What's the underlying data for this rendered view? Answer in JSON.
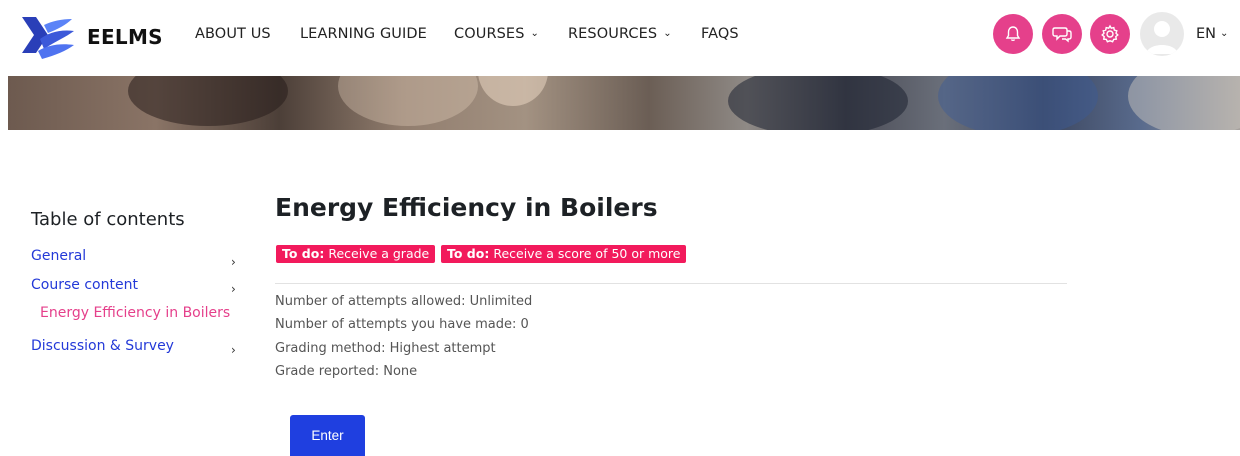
{
  "brand": {
    "name": "EELMS"
  },
  "nav": {
    "items": [
      {
        "label": "ABOUT US",
        "has_dropdown": false
      },
      {
        "label": "LEARNING GUIDE",
        "has_dropdown": false
      },
      {
        "label": "COURSES",
        "has_dropdown": true
      },
      {
        "label": "RESOURCES",
        "has_dropdown": true
      },
      {
        "label": "FAQS",
        "has_dropdown": false
      }
    ],
    "icons": [
      "bell-icon",
      "chat-icon",
      "gear-icon"
    ],
    "language": "EN",
    "accent_color": "#e5408b"
  },
  "toc": {
    "title": "Table of contents",
    "items": [
      {
        "label": "General",
        "active": false
      },
      {
        "label": "Course content",
        "active": false
      },
      {
        "label": "Energy Efficiency in Boilers",
        "active": true
      },
      {
        "label": "Discussion & Survey",
        "active": false
      }
    ]
  },
  "main": {
    "title": "Energy Efficiency in Boilers",
    "badges": [
      {
        "prefix": "To do:",
        "text": "Receive a grade"
      },
      {
        "prefix": "To do:",
        "text": "Receive a score of 50 or more"
      }
    ],
    "badge_color": "#f21a5c",
    "info": [
      "Number of attempts allowed: Unlimited",
      "Number of attempts you have made: 0",
      "Grading method: Highest attempt",
      "Grade reported: None"
    ],
    "enter_label": "Enter",
    "button_color": "#1f3fe0"
  }
}
